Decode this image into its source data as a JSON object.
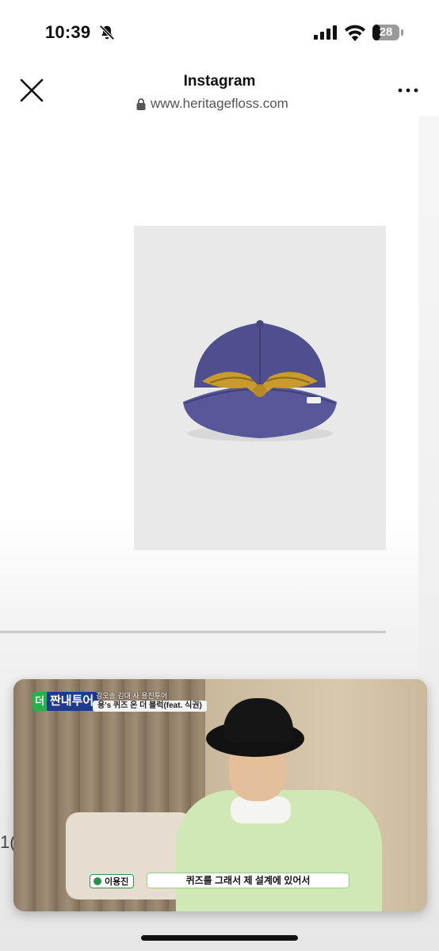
{
  "status_bar": {
    "time": "10:39",
    "battery": "28",
    "icons": [
      "bell-slash-icon",
      "cellular-signal-icon",
      "wifi-icon",
      "battery-icon"
    ]
  },
  "browser_header": {
    "title": "Instagram",
    "url": "www.heritagefloss.com",
    "icons": [
      "close-icon",
      "lock-icon",
      "more-icon"
    ]
  },
  "content": {
    "partial_text": "1("
  },
  "pip_video": {
    "show_logo": "짠내투어",
    "logo_tag": "더",
    "small_caption": "김오송 김대 사 용진투어",
    "caption": "용's 퀴즈 온 더 블럭(feat. 식권)",
    "name_tag": "이용진",
    "subtitle": "퀴즈를 그래서 제 설계에 있어서"
  },
  "colors": {
    "cap_navy": "#4f4f8f",
    "embroidery_gold": "#c99a2e",
    "pip_green": "#2f8f4a"
  }
}
